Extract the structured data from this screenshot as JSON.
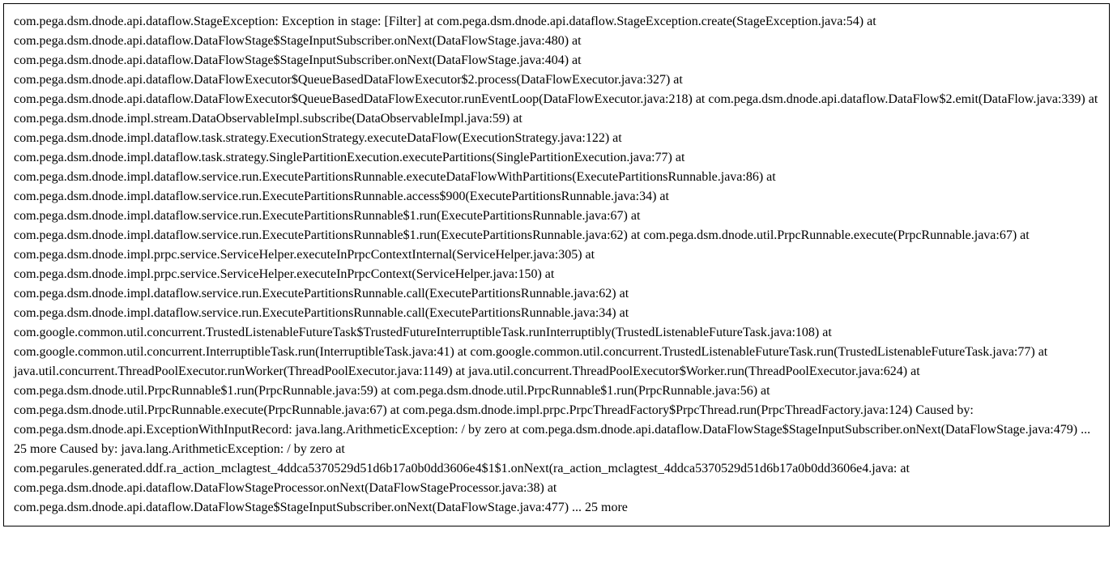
{
  "stacktrace": {
    "content": "com.pega.dsm.dnode.api.dataflow.StageException: Exception in stage: [Filter] at com.pega.dsm.dnode.api.dataflow.StageException.create(StageException.java:54) at com.pega.dsm.dnode.api.dataflow.DataFlowStage$StageInputSubscriber.onNext(DataFlowStage.java:480) at com.pega.dsm.dnode.api.dataflow.DataFlowStage$StageInputSubscriber.onNext(DataFlowStage.java:404) at com.pega.dsm.dnode.api.dataflow.DataFlowExecutor$QueueBasedDataFlowExecutor$2.process(DataFlowExecutor.java:327) at com.pega.dsm.dnode.api.dataflow.DataFlowExecutor$QueueBasedDataFlowExecutor.runEventLoop(DataFlowExecutor.java:218) at com.pega.dsm.dnode.api.dataflow.DataFlow$2.emit(DataFlow.java:339) at com.pega.dsm.dnode.impl.stream.DataObservableImpl.subscribe(DataObservableImpl.java:59) at com.pega.dsm.dnode.impl.dataflow.task.strategy.ExecutionStrategy.executeDataFlow(ExecutionStrategy.java:122) at com.pega.dsm.dnode.impl.dataflow.task.strategy.SinglePartitionExecution.executePartitions(SinglePartitionExecution.java:77) at com.pega.dsm.dnode.impl.dataflow.service.run.ExecutePartitionsRunnable.executeDataFlowWithPartitions(ExecutePartitionsRunnable.java:86) at com.pega.dsm.dnode.impl.dataflow.service.run.ExecutePartitionsRunnable.access$900(ExecutePartitionsRunnable.java:34) at com.pega.dsm.dnode.impl.dataflow.service.run.ExecutePartitionsRunnable$1.run(ExecutePartitionsRunnable.java:67) at com.pega.dsm.dnode.impl.dataflow.service.run.ExecutePartitionsRunnable$1.run(ExecutePartitionsRunnable.java:62) at com.pega.dsm.dnode.util.PrpcRunnable.execute(PrpcRunnable.java:67) at com.pega.dsm.dnode.impl.prpc.service.ServiceHelper.executeInPrpcContextInternal(ServiceHelper.java:305) at com.pega.dsm.dnode.impl.prpc.service.ServiceHelper.executeInPrpcContext(ServiceHelper.java:150) at com.pega.dsm.dnode.impl.dataflow.service.run.ExecutePartitionsRunnable.call(ExecutePartitionsRunnable.java:62) at com.pega.dsm.dnode.impl.dataflow.service.run.ExecutePartitionsRunnable.call(ExecutePartitionsRunnable.java:34) at com.google.common.util.concurrent.TrustedListenableFutureTask$TrustedFutureInterruptibleTask.runInterruptibly(TrustedListenableFutureTask.java:108) at com.google.common.util.concurrent.InterruptibleTask.run(InterruptibleTask.java:41) at com.google.common.util.concurrent.TrustedListenableFutureTask.run(TrustedListenableFutureTask.java:77) at java.util.concurrent.ThreadPoolExecutor.runWorker(ThreadPoolExecutor.java:1149) at java.util.concurrent.ThreadPoolExecutor$Worker.run(ThreadPoolExecutor.java:624) at com.pega.dsm.dnode.util.PrpcRunnable$1.run(PrpcRunnable.java:59) at com.pega.dsm.dnode.util.PrpcRunnable$1.run(PrpcRunnable.java:56) at com.pega.dsm.dnode.util.PrpcRunnable.execute(PrpcRunnable.java:67) at com.pega.dsm.dnode.impl.prpc.PrpcThreadFactory$PrpcThread.run(PrpcThreadFactory.java:124) Caused by: com.pega.dsm.dnode.api.ExceptionWithInputRecord: java.lang.ArithmeticException: / by zero at com.pega.dsm.dnode.api.dataflow.DataFlowStage$StageInputSubscriber.onNext(DataFlowStage.java:479) ... 25 more Caused by: java.lang.ArithmeticException: / by zero at com.pegarules.generated.ddf.ra_action_mclagtest_4ddca5370529d51d6b17a0b0dd3606e4$1$1.onNext(ra_action_mclagtest_4ddca5370529d51d6b17a0b0dd3606e4.java: at com.pega.dsm.dnode.api.dataflow.DataFlowStageProcessor.onNext(DataFlowStageProcessor.java:38) at com.pega.dsm.dnode.api.dataflow.DataFlowStage$StageInputSubscriber.onNext(DataFlowStage.java:477) ... 25 more"
  }
}
